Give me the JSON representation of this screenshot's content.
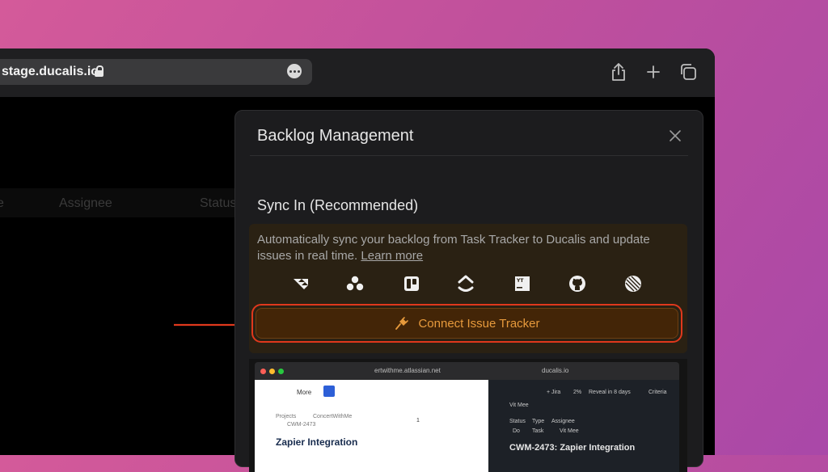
{
  "browser": {
    "url": "stage.ducalis.io",
    "icons": [
      "lock-icon",
      "more-icon",
      "share-icon",
      "new-tab-icon",
      "tabs-icon"
    ]
  },
  "background_table": {
    "columns": [
      "e",
      "Assignee",
      "Status"
    ]
  },
  "modal": {
    "title": "Backlog Management",
    "sync_heading": "Sync In (Recommended)",
    "description": "Automatically sync your backlog from Task Tracker to Ducalis and update issues in real time.",
    "learn_more": "Learn more",
    "integrations": [
      "jira",
      "asana",
      "trello",
      "clickup",
      "youtrack",
      "github",
      "linear"
    ],
    "connect_button": "Connect Issue Tracker"
  },
  "preview": {
    "left_url": "ertwithme.atlassian.net",
    "right_url": "ducalis.io",
    "more_label": "More",
    "breadcrumb_projects": "Projects",
    "breadcrumb_project": "ConcertWithMe",
    "issue_key": "CWM-2473",
    "issue_title": "Zapier Integration",
    "watch_count": "1",
    "right_jira": "+ Jira",
    "right_percent": "2%",
    "right_reveal": "Reveal in 8 days",
    "right_criteria": "Criteria",
    "right_user": "Vit Mee",
    "right_cols": [
      "Status",
      "Type",
      "Assignee"
    ],
    "right_row": [
      "Do",
      "Task",
      "Vit Mee"
    ],
    "right_issue_title": "CWM-2473: Zapier Integration"
  },
  "colors": {
    "accent": "#e79a3c",
    "highlight": "#e0381c",
    "modal_bg": "#1c1c1e"
  }
}
